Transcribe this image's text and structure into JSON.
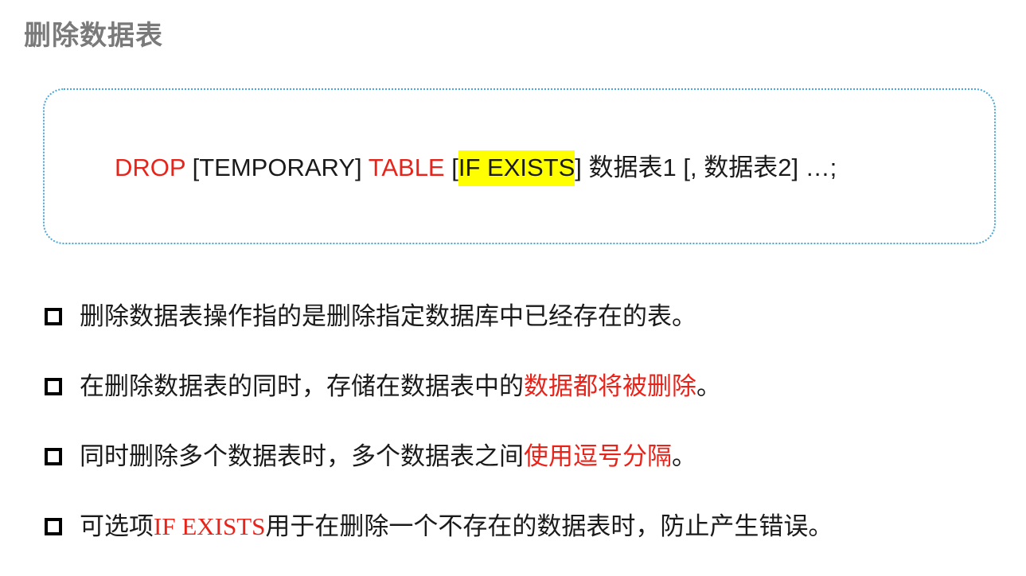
{
  "title": "删除数据表",
  "syntax": {
    "drop": "DROP",
    "temporary": " [TEMPORARY] ",
    "table": "TABLE",
    "space1": " ",
    "bracket_open": "[",
    "if_exists": "IF EXISTS",
    "rest": "] 数据表1 [, 数据表2] …;"
  },
  "bullets": [
    {
      "pre": "删除数据表操作指的是删除指定数据库中已经存在的表。",
      "highlight": "",
      "post": ""
    },
    {
      "pre": "在删除数据表的同时，存储在数据表中的",
      "highlight": "数据都将被删除",
      "post": "。"
    },
    {
      "pre": "同时删除多个数据表时，多个数据表之间",
      "highlight": "使用逗号分隔",
      "post": "。"
    },
    {
      "pre": "可选项",
      "highlight": "IF EXISTS",
      "post": "用于在删除一个不存在的数据表时，防止产生错误。"
    }
  ],
  "colors": {
    "keyword": "#e8231a",
    "highlight_bg": "#ffff00",
    "box_border": "#4aa8d8",
    "title": "#7a7a7a"
  }
}
